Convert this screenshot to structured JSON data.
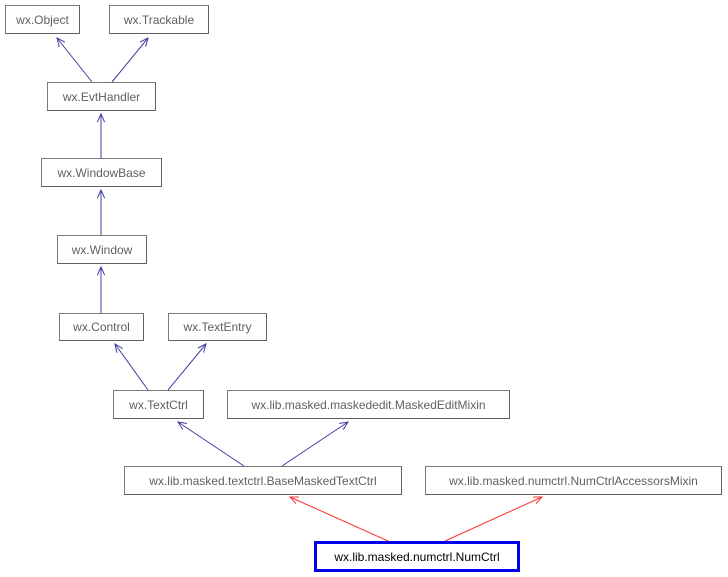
{
  "diagram": {
    "nodes": [
      {
        "id": "object",
        "label": "wx.Object"
      },
      {
        "id": "trackable",
        "label": "wx.Trackable"
      },
      {
        "id": "evthandler",
        "label": "wx.EvtHandler"
      },
      {
        "id": "windowbase",
        "label": "wx.WindowBase"
      },
      {
        "id": "window",
        "label": "wx.Window"
      },
      {
        "id": "control",
        "label": "wx.Control"
      },
      {
        "id": "textentry",
        "label": "wx.TextEntry"
      },
      {
        "id": "textctrl",
        "label": "wx.TextCtrl"
      },
      {
        "id": "maskededitmixin",
        "label": "wx.lib.masked.maskededit.MaskedEditMixin"
      },
      {
        "id": "basemaskedtextctrl",
        "label": "wx.lib.masked.textctrl.BaseMaskedTextCtrl"
      },
      {
        "id": "numctrlaccessorsmixin",
        "label": "wx.lib.masked.numctrl.NumCtrlAccessorsMixin"
      },
      {
        "id": "numctrl",
        "label": "wx.lib.masked.numctrl.NumCtrl",
        "current": true
      }
    ],
    "edges": [
      {
        "from": "evthandler",
        "to": "object",
        "kind": "inherit"
      },
      {
        "from": "evthandler",
        "to": "trackable",
        "kind": "inherit"
      },
      {
        "from": "windowbase",
        "to": "evthandler",
        "kind": "inherit"
      },
      {
        "from": "window",
        "to": "windowbase",
        "kind": "inherit"
      },
      {
        "from": "control",
        "to": "window",
        "kind": "inherit"
      },
      {
        "from": "textctrl",
        "to": "control",
        "kind": "inherit"
      },
      {
        "from": "textctrl",
        "to": "textentry",
        "kind": "inherit"
      },
      {
        "from": "basemaskedtextctrl",
        "to": "textctrl",
        "kind": "inherit"
      },
      {
        "from": "basemaskedtextctrl",
        "to": "maskededitmixin",
        "kind": "inherit"
      },
      {
        "from": "numctrl",
        "to": "basemaskedtextctrl",
        "kind": "direct"
      },
      {
        "from": "numctrl",
        "to": "numctrlaccessorsmixin",
        "kind": "direct"
      }
    ],
    "colors": {
      "inherit_edge": "#3f3fa0",
      "direct_edge": "#ff3030",
      "current_border": "#0000ee"
    }
  }
}
